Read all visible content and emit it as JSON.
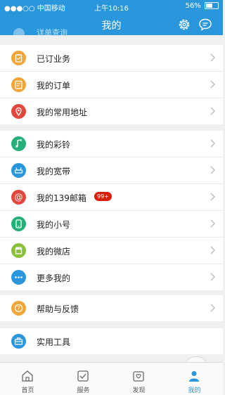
{
  "status_bar": {
    "carrier": "●●●○○ 中国移动",
    "time": "上午10:16",
    "battery": "56%",
    "battery_level": 0.56
  },
  "header": {
    "title": "我的",
    "peek_text": "详单查询",
    "settings_icon": "gear-icon",
    "message_icon": "chat-bubble-icon"
  },
  "group1": [
    {
      "label": "已订业务",
      "color": "#f0a63a",
      "icon": "clipboard-icon"
    },
    {
      "label": "我的订单",
      "color": "#f0a63a",
      "icon": "order-icon"
    },
    {
      "label": "我的常用地址",
      "color": "#e2483d",
      "icon": "location-icon"
    }
  ],
  "group2": [
    {
      "label": "我的彩铃",
      "color": "#23b079",
      "icon": "music-note-icon"
    },
    {
      "label": "我的宽带",
      "color": "#2a97dc",
      "icon": "router-icon"
    },
    {
      "label": "我的139邮箱",
      "color": "#e2483d",
      "icon": "at-sign-icon",
      "badge": "99+"
    },
    {
      "label": "我的小号",
      "color": "#23b079",
      "icon": "phone-icon"
    },
    {
      "label": "我的微店",
      "color": "#8bc13a",
      "icon": "shop-icon"
    },
    {
      "label": "更多我的",
      "color": "#2a97dc",
      "icon": "more-dots-icon"
    }
  ],
  "group3": [
    {
      "label": "帮助与反馈",
      "color": "#f0a63a",
      "icon": "help-icon"
    }
  ],
  "group4": [
    {
      "label": "实用工具",
      "color": "#2a97dc",
      "icon": "toolbox-icon"
    }
  ],
  "tabs": [
    {
      "label": "首页",
      "icon": "home-icon"
    },
    {
      "label": "服务",
      "icon": "service-icon"
    },
    {
      "label": "发现",
      "icon": "discover-icon"
    },
    {
      "label": "我的",
      "icon": "profile-icon",
      "active": true
    }
  ],
  "colors": {
    "accent": "#2a97dc",
    "badge": "#d81e06"
  }
}
